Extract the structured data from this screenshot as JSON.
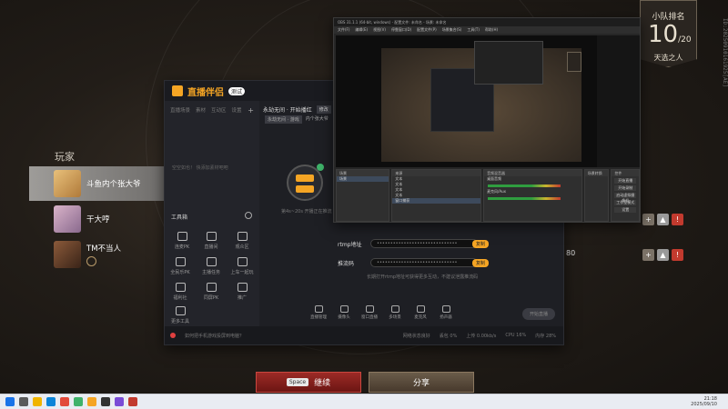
{
  "rank": {
    "title": "小队排名",
    "position": "10",
    "total": "/20",
    "subtitle": "天选之人"
  },
  "side_code": "ID:20250910161925[AE]",
  "players": {
    "heading": "玩家",
    "list": [
      {
        "name": "斗鱼内个张大爷",
        "selected": true
      },
      {
        "name": "干大哼",
        "selected": false
      },
      {
        "name": "TM不当人",
        "selected": false
      }
    ],
    "score": "80"
  },
  "buttons": {
    "continue_key": "Space",
    "continue_label": "继续",
    "share_label": "分享"
  },
  "helper": {
    "app_name": "直播伴侣",
    "version_badge": "测试",
    "tabs": [
      "直播场景",
      "素材",
      "互动区",
      "设置"
    ],
    "empty_hint": "空空如也！ 快添加素材吧吧",
    "stream_title": "永劫无间 · 开始播红",
    "edit_label": "修改",
    "category": "永劫无间 · 游戏",
    "category_sub": "内个张大爷",
    "tools_heading": "工具箱",
    "tools": [
      {
        "label": "连麦PK"
      },
      {
        "label": "直播间"
      },
      {
        "label": "观众区"
      },
      {
        "label": "全民乐PK"
      },
      {
        "label": "主播任务"
      },
      {
        "label": "上车一起玩"
      },
      {
        "label": "福利社"
      },
      {
        "label": "同屏PK"
      },
      {
        "label": "推广"
      },
      {
        "label": "更多工具"
      }
    ],
    "preview_hint": "第4s~20s 开播正在推流",
    "rtmp_label": "rtmp地址",
    "rtmp_value": "••••••••••••••••••••••••••••••",
    "key_label": "推流码",
    "key_value": "••••••••••••••••••••••••••••••",
    "copy_label": "复制",
    "notice": "长期打开rtmp地址可获得更多互动，不建议泄露推流码",
    "toolbar": [
      "直播管理",
      "摄像头",
      "窗口直播",
      "多场景",
      "麦克风",
      "扬声器"
    ],
    "start_label": "开始直播",
    "status_warn": "如何把手机游戏投屏到电脑？",
    "status_right": [
      "网络状态良好",
      "丢包 0%",
      "上传 0.00kb/s",
      "CPU 16%",
      "内存 28%"
    ]
  },
  "obs": {
    "title": "OBS 31.1.1 (64-bit, windows) - 配置文件: 未命名 - 场景: 未命名",
    "menu": [
      "文件(F)",
      "编辑(E)",
      "视图(V)",
      "停靠窗口(D)",
      "配置文件(P)",
      "场景集合(S)",
      "工具(T)",
      "帮助(H)"
    ],
    "scenes_h": "场景",
    "scene_item": "场景",
    "sources_h": "来源",
    "sources": [
      "文本",
      "文本",
      "文本",
      "文本",
      "窗口捕获"
    ],
    "mixer_h": "音频混音器",
    "tracks": [
      "桌面音频",
      "麦克风/Aux"
    ],
    "trans_h": "场景转换",
    "controls_h": "控件",
    "controls": [
      "开始直播",
      "开始录制",
      "启动虚拟摄像机",
      "工作室模式",
      "设置",
      "退出"
    ]
  },
  "taskbar": {
    "time": "21:18",
    "date": "2025/09/10"
  },
  "colors": {
    "accent": "#f5a524",
    "continue": "#9c2a26",
    "share": "#6a5c4a"
  }
}
